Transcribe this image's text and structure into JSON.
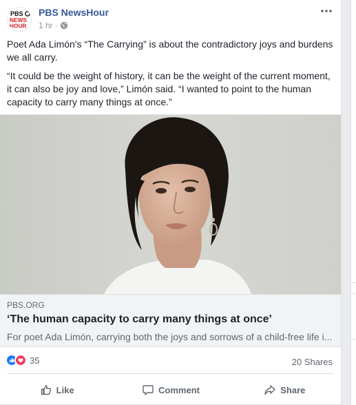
{
  "post": {
    "page_name": "PBS NewsHour",
    "time": "1 hr",
    "separator": "·",
    "logo_text": [
      "PBS",
      "NEWS",
      "HOUR"
    ],
    "paragraphs": [
      "Poet Ada Limón's “The Carrying” is about the contradictory joys and burdens we all carry.",
      "“It could be the weight of history, it can be the weight of the current moment, it can also be joy and love,” Limón said. “I wanted to point to the human capacity to carry many things at once.”"
    ]
  },
  "link": {
    "domain": "PBS.ORG",
    "title": "‘The human capacity to carry many things at once’",
    "description": "For poet Ada Limón, carrying both the joys and sorrows of a child-free life i..."
  },
  "stats": {
    "reaction_count": "35",
    "shares": "20 Shares",
    "reaction_icons": [
      "like-reaction",
      "love-reaction"
    ]
  },
  "actions": {
    "like": "Like",
    "comment": "Comment",
    "share": "Share"
  },
  "colors": {
    "brand_blue": "#385898",
    "like_blue": "#1877f2",
    "love_red": "#f33e58",
    "pbs_red": "#d61f26",
    "link_bg": "#f2f3f5"
  }
}
